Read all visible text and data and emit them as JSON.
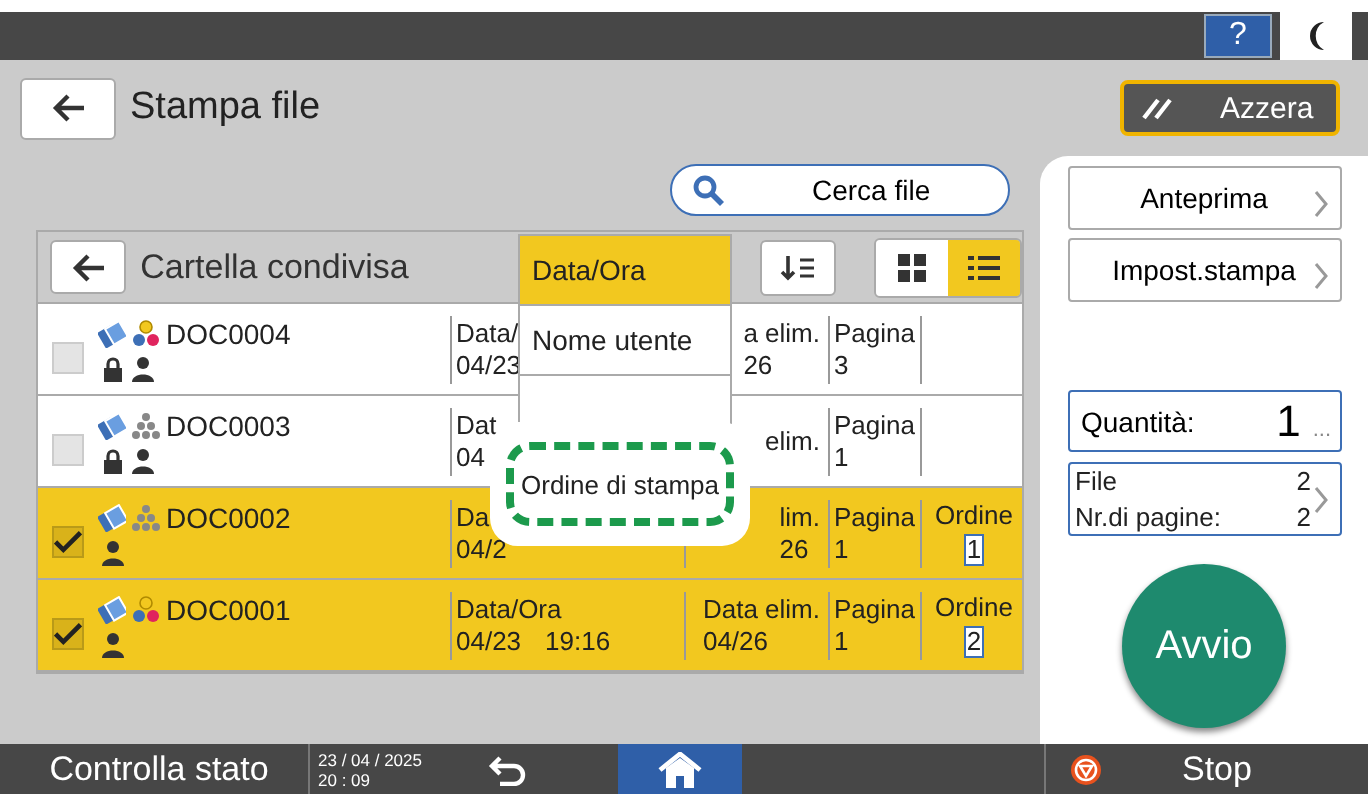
{
  "top_bar": {
    "help": "?"
  },
  "header": {
    "title": "Stampa file",
    "reset_button": "Azzera"
  },
  "search_button": "Cerca file",
  "folder": {
    "title": "Cartella condivisa"
  },
  "sort_menu": {
    "options": [
      {
        "label": "Data/Ora",
        "selected": true
      },
      {
        "label": "Nome utente",
        "selected": false
      }
    ],
    "highlight": "Ordine di stampa"
  },
  "view_toggle": [
    {
      "kind": "grid",
      "selected": false
    },
    {
      "kind": "list",
      "selected": true
    }
  ],
  "files": [
    {
      "name": "DOC0004",
      "selected": false,
      "color_print": true,
      "locked": true,
      "date_label": "Data/",
      "date_value": "04/23",
      "deletion_label": "a elim.",
      "deletion_value": "26",
      "pages_label": "Pagina",
      "pages": "3"
    },
    {
      "name": "DOC0003",
      "selected": false,
      "color_print": false,
      "locked": true,
      "date_label": "Dat",
      "date_value": "04",
      "deletion_label": "elim.",
      "pages_label": "Pagina",
      "pages": "1"
    },
    {
      "name": "DOC0002",
      "selected": true,
      "color_print": false,
      "locked": false,
      "date_label": "Da",
      "date_value": "04/2",
      "deletion_label": "lim.",
      "deletion_value": "26",
      "pages_label": "Pagina",
      "pages": "1",
      "order_label": "Ordine",
      "order": "1"
    },
    {
      "name": "DOC0001",
      "selected": true,
      "color_print": true,
      "locked": false,
      "date_label": "Data/Ora",
      "date_value": "04/23",
      "date_time": "19:16",
      "deletion_label": "Data elim.",
      "deletion_value": "04/26",
      "pages_label": "Pagina",
      "pages": "1",
      "order_label": "Ordine",
      "order": "2"
    }
  ],
  "side_panel": {
    "buttons": [
      "Anteprima",
      "Impost.stampa"
    ],
    "quantity": {
      "label": "Quantità:",
      "value": "1",
      "more": "..."
    },
    "summary": {
      "files_label": "File",
      "files": "2",
      "pages_label": "Nr.di pagine:",
      "pages": "2"
    },
    "start": "Avvio"
  },
  "bottom_bar": {
    "status": "Controlla stato",
    "date": "23 / 04 / 2025",
    "time": "20 : 09",
    "stop": "Stop"
  }
}
